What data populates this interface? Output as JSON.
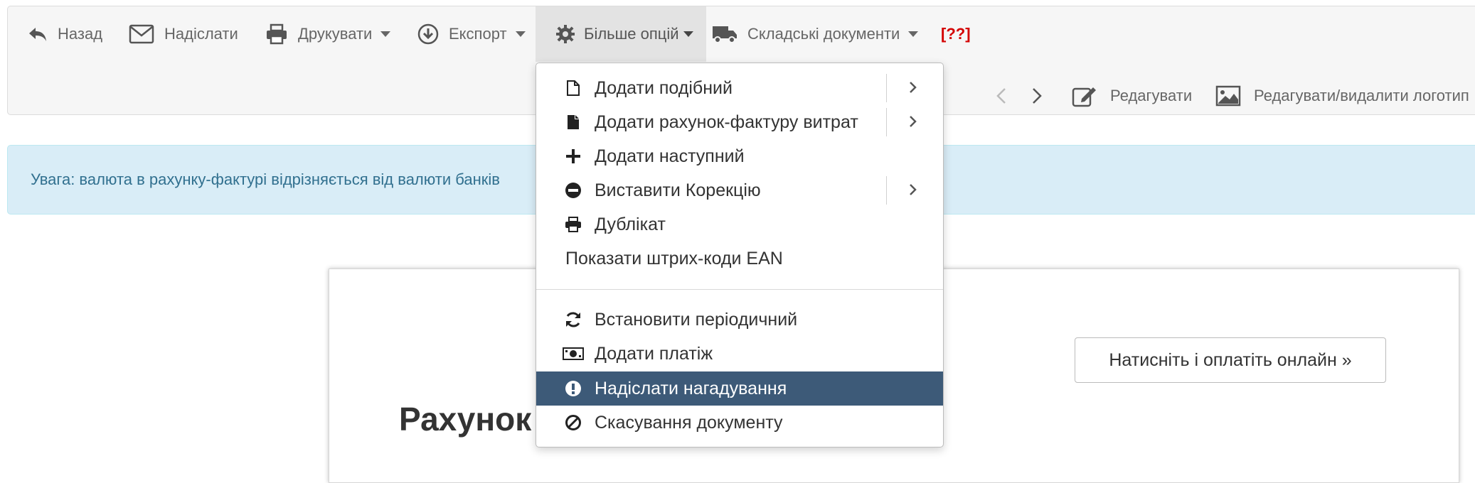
{
  "toolbar": {
    "back": "Назад",
    "send": "Надіслати",
    "print": "Друкувати",
    "export": "Експорт",
    "more": "Більше опцій",
    "warehouse": "Складські документи",
    "unknown": "[??]",
    "edit": "Редагувати",
    "edit_logo": "Редагувати/видалити логотип"
  },
  "alert": {
    "text": "Увага: валюта в рахунку-фактурі відрізняється від валюти банків"
  },
  "menu": {
    "items": [
      {
        "label": "Додати подібний",
        "icon": "file-icon",
        "submenu": true
      },
      {
        "label": "Додати рахунок-фактуру витрат",
        "icon": "file-filled-icon",
        "submenu": true
      },
      {
        "label": "Додати наступний",
        "icon": "plus-icon",
        "submenu": false
      },
      {
        "label": "Виставити Корекцію",
        "icon": "minus-circle-icon",
        "submenu": true
      },
      {
        "label": "Дублікат",
        "icon": "printer-icon",
        "submenu": false
      },
      {
        "label": "Показати штрих-коди EAN",
        "icon": "",
        "submenu": false
      },
      {
        "label": "Встановити періодичний",
        "icon": "refresh-icon",
        "submenu": false
      },
      {
        "label": "Додати платіж",
        "icon": "money-icon",
        "submenu": false
      },
      {
        "label": "Надіслати нагадування",
        "icon": "exclamation-circle-icon",
        "submenu": false
      },
      {
        "label": "Скасування документу",
        "icon": "ban-icon",
        "submenu": false
      }
    ],
    "highlighted_index": 8
  },
  "document": {
    "title": "Рахунок",
    "pay_button": "Натисніть і оплатіть онлайн »"
  },
  "colors": {
    "highlight": "#3d5a78",
    "alert_bg": "#d9edf7",
    "alert_text": "#31708f",
    "warning_red": "#d40000"
  }
}
